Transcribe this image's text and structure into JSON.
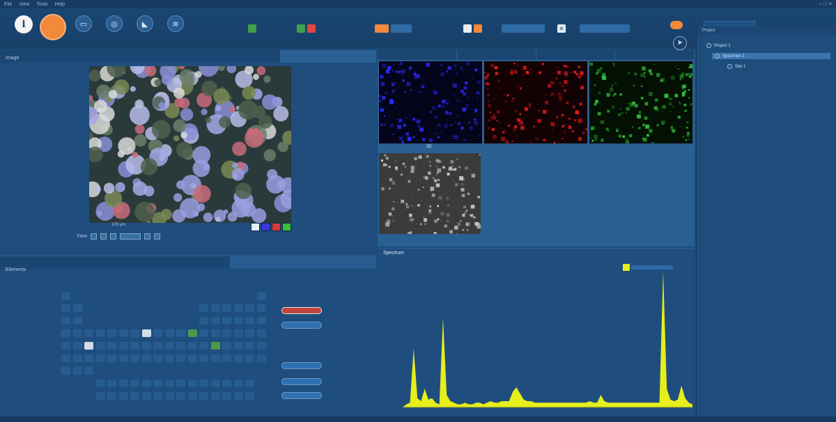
{
  "menu": {
    "items": [
      "File",
      "View",
      "Tools",
      "Help"
    ],
    "window_controls": "– □ ×"
  },
  "toolbar": {
    "info_icon": "info-icon",
    "main_icon": "acquire-icon",
    "tools": [
      {
        "name": "screen-icon",
        "glyph": "▭"
      },
      {
        "name": "settings-icon",
        "glyph": "◎"
      },
      {
        "name": "chart-icon",
        "glyph": "◣"
      },
      {
        "name": "layers-icon",
        "glyph": "≋"
      }
    ]
  },
  "image_panel": {
    "title": "Image",
    "caption": "100 µm",
    "tools_label": "View"
  },
  "periodic_panel": {
    "title": "Elements",
    "buttons": [
      "",
      "",
      "",
      "",
      ""
    ]
  },
  "maps_panel": {
    "tabs": [
      "",
      "",
      "",
      ""
    ],
    "sem_label": "SE",
    "status": ""
  },
  "spectrum_panel": {
    "title": "Spectrum",
    "legend": "",
    "colors": {
      "spectrum": "#e6ef1a",
      "baseline": "#6f7f2f"
    }
  },
  "tree_panel": {
    "header": "Project",
    "items": [
      "Project 1",
      "Specimen 1",
      "Site 1"
    ]
  },
  "chart_data": {
    "type": "area",
    "series": [
      {
        "values": [
          0,
          2,
          3,
          38,
          6,
          4,
          12,
          5,
          6,
          3,
          2,
          58,
          8,
          4,
          3,
          2,
          2,
          3,
          2,
          2,
          3,
          3,
          2,
          3,
          4,
          3,
          3,
          4,
          4,
          4,
          10,
          13,
          9,
          5,
          4,
          4,
          3,
          3,
          3,
          3,
          3,
          3,
          3,
          3,
          3,
          3,
          3,
          3,
          3,
          3,
          3,
          4,
          3,
          3,
          8,
          4,
          3,
          3,
          3,
          3,
          3,
          3,
          3,
          3,
          3,
          3,
          3,
          3,
          3,
          3,
          3,
          88,
          12,
          5,
          4,
          5,
          14,
          6,
          3,
          2
        ]
      }
    ],
    "ylim": [
      0,
      90
    ],
    "grid": false,
    "legend": "top-right"
  }
}
